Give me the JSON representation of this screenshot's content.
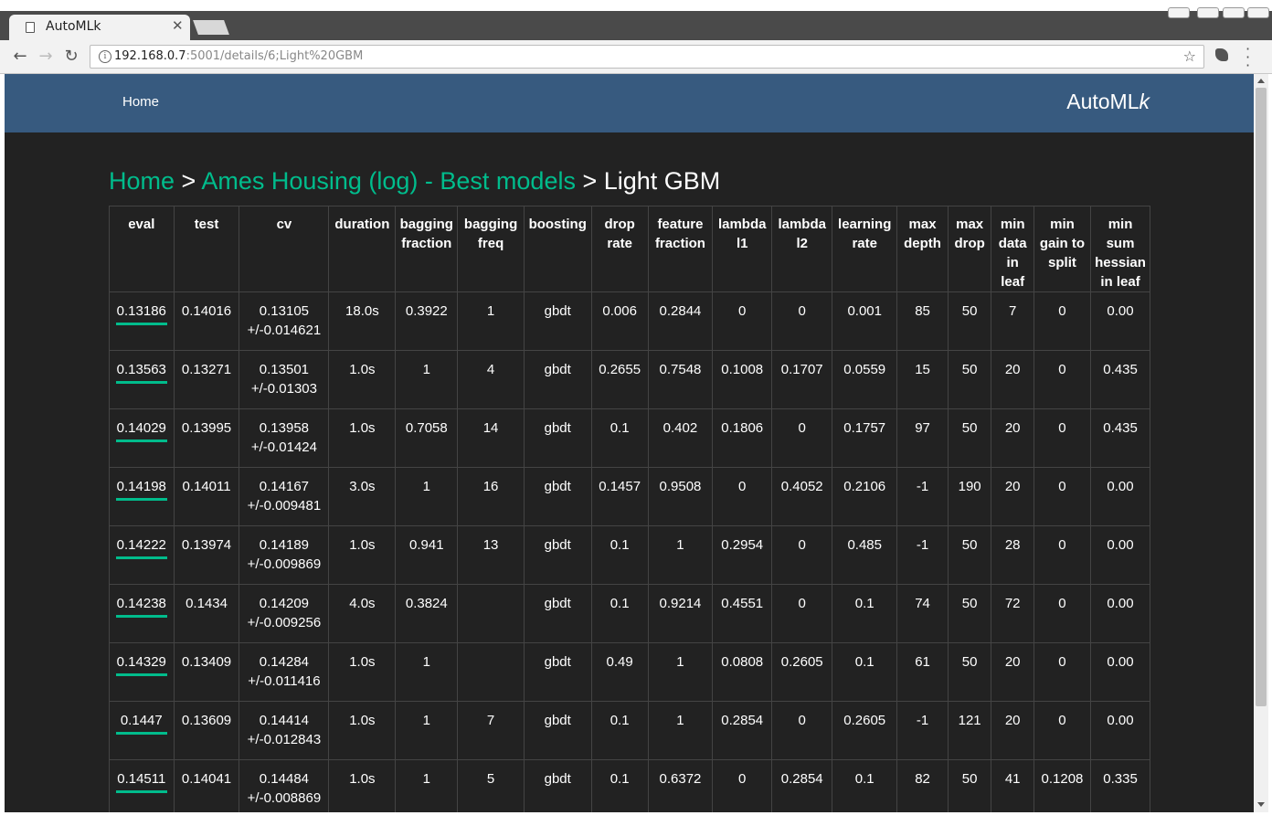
{
  "browser": {
    "tab_title": "AutoMLk",
    "url_host": "192.168.0.7",
    "url_rest": ":5001/details/6;Light%20GBM"
  },
  "navbar": {
    "home_label": "Home",
    "brand_main": "AutoML",
    "brand_italic": "k"
  },
  "breadcrumb": {
    "home": "Home",
    "sep1": " > ",
    "dataset": "Ames Housing (log) - Best models",
    "sep2": " > ",
    "current": "Light GBM"
  },
  "table": {
    "headers": [
      "eval",
      "test",
      "cv",
      "duration",
      "bagging fraction",
      "bagging freq",
      "boosting",
      "drop rate",
      "feature fraction",
      "lambda l1",
      "lambda l2",
      "learning rate",
      "max depth",
      "max drop",
      "min data in leaf",
      "min gain to split",
      "min sum hessian in leaf"
    ],
    "rows": [
      {
        "eval": "0.13186",
        "test": "0.14016",
        "cv1": "0.13105",
        "cv2": "+/-0.014621",
        "duration": "18.0s",
        "bagging_fraction": "0.3922",
        "bagging_freq": "1",
        "boosting": "gbdt",
        "drop_rate": "0.006",
        "feature_fraction": "0.2844",
        "lambda_l1": "0",
        "lambda_l2": "0",
        "learning_rate": "0.001",
        "max_depth": "85",
        "max_drop": "50",
        "min_data_in_leaf": "7",
        "min_gain_to_split": "0",
        "min_sum_hessian": "0.00"
      },
      {
        "eval": "0.13563",
        "test": "0.13271",
        "cv1": "0.13501",
        "cv2": "+/-0.01303",
        "duration": "1.0s",
        "bagging_fraction": "1",
        "bagging_freq": "4",
        "boosting": "gbdt",
        "drop_rate": "0.2655",
        "feature_fraction": "0.7548",
        "lambda_l1": "0.1008",
        "lambda_l2": "0.1707",
        "learning_rate": "0.0559",
        "max_depth": "15",
        "max_drop": "50",
        "min_data_in_leaf": "20",
        "min_gain_to_split": "0",
        "min_sum_hessian": "0.435"
      },
      {
        "eval": "0.14029",
        "test": "0.13995",
        "cv1": "0.13958",
        "cv2": "+/-0.01424",
        "duration": "1.0s",
        "bagging_fraction": "0.7058",
        "bagging_freq": "14",
        "boosting": "gbdt",
        "drop_rate": "0.1",
        "feature_fraction": "0.402",
        "lambda_l1": "0.1806",
        "lambda_l2": "0",
        "learning_rate": "0.1757",
        "max_depth": "97",
        "max_drop": "50",
        "min_data_in_leaf": "20",
        "min_gain_to_split": "0",
        "min_sum_hessian": "0.435"
      },
      {
        "eval": "0.14198",
        "test": "0.14011",
        "cv1": "0.14167",
        "cv2": "+/-0.009481",
        "duration": "3.0s",
        "bagging_fraction": "1",
        "bagging_freq": "16",
        "boosting": "gbdt",
        "drop_rate": "0.1457",
        "feature_fraction": "0.9508",
        "lambda_l1": "0",
        "lambda_l2": "0.4052",
        "learning_rate": "0.2106",
        "max_depth": "-1",
        "max_drop": "190",
        "min_data_in_leaf": "20",
        "min_gain_to_split": "0",
        "min_sum_hessian": "0.00"
      },
      {
        "eval": "0.14222",
        "test": "0.13974",
        "cv1": "0.14189",
        "cv2": "+/-0.009869",
        "duration": "1.0s",
        "bagging_fraction": "0.941",
        "bagging_freq": "13",
        "boosting": "gbdt",
        "drop_rate": "0.1",
        "feature_fraction": "1",
        "lambda_l1": "0.2954",
        "lambda_l2": "0",
        "learning_rate": "0.485",
        "max_depth": "-1",
        "max_drop": "50",
        "min_data_in_leaf": "28",
        "min_gain_to_split": "0",
        "min_sum_hessian": "0.00"
      },
      {
        "eval": "0.14238",
        "test": "0.1434",
        "cv1": "0.14209",
        "cv2": "+/-0.009256",
        "duration": "4.0s",
        "bagging_fraction": "0.3824",
        "bagging_freq": "",
        "boosting": "gbdt",
        "drop_rate": "0.1",
        "feature_fraction": "0.9214",
        "lambda_l1": "0.4551",
        "lambda_l2": "0",
        "learning_rate": "0.1",
        "max_depth": "74",
        "max_drop": "50",
        "min_data_in_leaf": "72",
        "min_gain_to_split": "0",
        "min_sum_hessian": "0.00"
      },
      {
        "eval": "0.14329",
        "test": "0.13409",
        "cv1": "0.14284",
        "cv2": "+/-0.011416",
        "duration": "1.0s",
        "bagging_fraction": "1",
        "bagging_freq": "",
        "boosting": "gbdt",
        "drop_rate": "0.49",
        "feature_fraction": "1",
        "lambda_l1": "0.0808",
        "lambda_l2": "0.2605",
        "learning_rate": "0.1",
        "max_depth": "61",
        "max_drop": "50",
        "min_data_in_leaf": "20",
        "min_gain_to_split": "0",
        "min_sum_hessian": "0.00"
      },
      {
        "eval": "0.1447",
        "test": "0.13609",
        "cv1": "0.14414",
        "cv2": "+/-0.012843",
        "duration": "1.0s",
        "bagging_fraction": "1",
        "bagging_freq": "7",
        "boosting": "gbdt",
        "drop_rate": "0.1",
        "feature_fraction": "1",
        "lambda_l1": "0.2854",
        "lambda_l2": "0",
        "learning_rate": "0.2605",
        "max_depth": "-1",
        "max_drop": "121",
        "min_data_in_leaf": "20",
        "min_gain_to_split": "0",
        "min_sum_hessian": "0.00"
      },
      {
        "eval": "0.14511",
        "test": "0.14041",
        "cv1": "0.14484",
        "cv2": "+/-0.008869",
        "duration": "1.0s",
        "bagging_fraction": "1",
        "bagging_freq": "5",
        "boosting": "gbdt",
        "drop_rate": "0.1",
        "feature_fraction": "0.6372",
        "lambda_l1": "0",
        "lambda_l2": "0.2854",
        "learning_rate": "0.1",
        "max_depth": "82",
        "max_drop": "50",
        "min_data_in_leaf": "41",
        "min_gain_to_split": "0.1208",
        "min_sum_hessian": "0.335"
      }
    ]
  },
  "colors": {
    "page_bg": "#222222",
    "navbar_bg": "#375a7f",
    "link": "#00bc8c",
    "border": "#444444"
  },
  "icons": [
    "page-icon",
    "close-icon",
    "back-icon",
    "forward-icon",
    "reload-icon",
    "info-icon",
    "star-icon",
    "extension-icon",
    "menu-icon"
  ]
}
